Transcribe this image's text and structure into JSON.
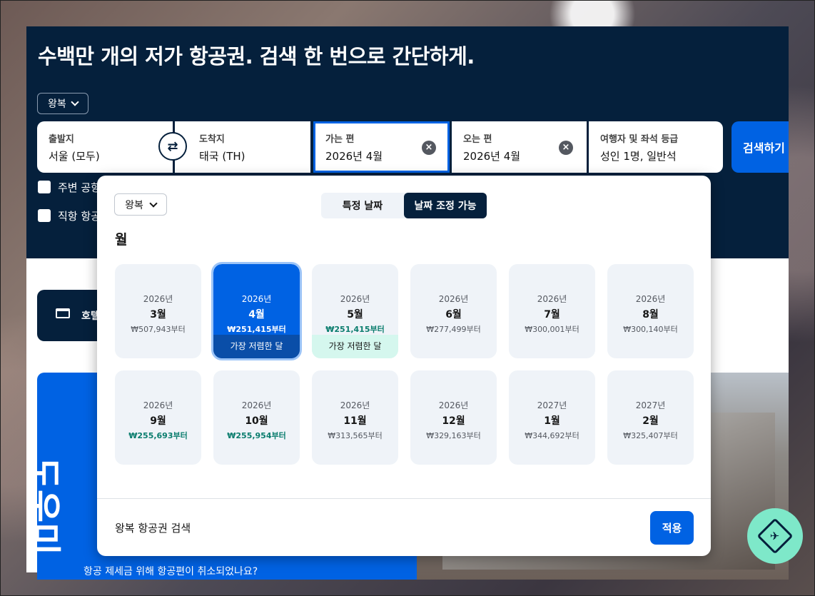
{
  "hero": {
    "title": "수백만 개의 저가 항공권. 검색 한 번으로 간단하게.",
    "trip_type": "왕복"
  },
  "search": {
    "origin": {
      "label": "출발지",
      "value": "서울 (모두)"
    },
    "destination": {
      "label": "도착지",
      "value": "태국 (TH)"
    },
    "depart": {
      "label": "가는 편",
      "value": "2026년 4월"
    },
    "return": {
      "label": "오는 편",
      "value": "2026년 4월"
    },
    "travellers": {
      "label": "여행자 및 좌석 등급",
      "value": "성인 1명, 일반석"
    },
    "search_button": "검색하기",
    "checkbox_nearby": "주변 공항",
    "checkbox_direct": "직항 항공"
  },
  "hotel_bar": {
    "label": "호텔"
  },
  "promo": {
    "vertical_text": "도우미",
    "subtext": "항공 제세금 위해 항공편이 취소되었나요?"
  },
  "colors": {
    "navy": "#05203c",
    "blue": "#0062e3",
    "mint": "#7ee8c9"
  },
  "picker": {
    "trip_type": "왕복",
    "tabs": {
      "specific": "특정 날짜",
      "flexible": "날짜 조정 가능",
      "active": "flexible"
    },
    "heading": "월",
    "cheapest_label": "가장 저렴한 달",
    "months": [
      {
        "year": "2026년",
        "month": "3월",
        "price": "₩507,943부터",
        "selected": false,
        "cheap": false
      },
      {
        "year": "2026년",
        "month": "4월",
        "price": "₩251,415부터",
        "selected": true,
        "cheap": true,
        "tag": "가장 저렴한 달"
      },
      {
        "year": "2026년",
        "month": "5월",
        "price": "₩251,415부터",
        "selected": false,
        "cheap": true,
        "tag": "가장 저렴한 달"
      },
      {
        "year": "2026년",
        "month": "6월",
        "price": "₩277,499부터",
        "selected": false,
        "cheap": false
      },
      {
        "year": "2026년",
        "month": "7월",
        "price": "₩300,001부터",
        "selected": false,
        "cheap": false
      },
      {
        "year": "2026년",
        "month": "8월",
        "price": "₩300,140부터",
        "selected": false,
        "cheap": false
      },
      {
        "year": "2026년",
        "month": "9월",
        "price": "₩255,693부터",
        "selected": false,
        "cheap": true
      },
      {
        "year": "2026년",
        "month": "10월",
        "price": "₩255,954부터",
        "selected": false,
        "cheap": true
      },
      {
        "year": "2026년",
        "month": "11월",
        "price": "₩313,565부터",
        "selected": false,
        "cheap": false
      },
      {
        "year": "2026년",
        "month": "12월",
        "price": "₩329,163부터",
        "selected": false,
        "cheap": false
      },
      {
        "year": "2027년",
        "month": "1월",
        "price": "₩344,692부터",
        "selected": false,
        "cheap": false
      },
      {
        "year": "2027년",
        "month": "2월",
        "price": "₩325,407부터",
        "selected": false,
        "cheap": false
      }
    ],
    "footer_text": "왕복 항공권 검색",
    "apply_button": "적용"
  }
}
